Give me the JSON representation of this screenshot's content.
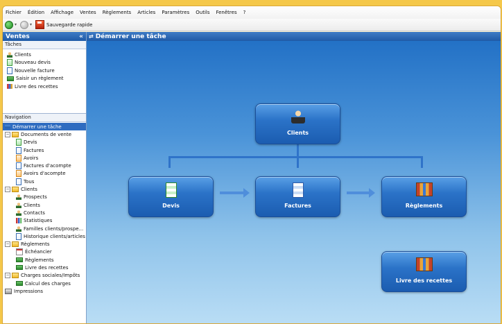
{
  "menu": [
    "Fichier",
    "Édition",
    "Affichage",
    "Ventes",
    "Règlements",
    "Articles",
    "Paramètres",
    "Outils",
    "Fenêtres",
    "?"
  ],
  "toolbar": {
    "save_label": "Sauvegarde rapide"
  },
  "sidebar": {
    "title": "Ventes",
    "collapse": "«",
    "tasks_title": "Tâches",
    "tasks": [
      "Clients",
      "Nouveau devis",
      "Nouvelle facture",
      "Saisir un règlement",
      "Livre des recettes"
    ],
    "nav_title": "Navigation",
    "tree": [
      {
        "label": "Démarrer une tâche"
      },
      {
        "label": "Documents de vente"
      },
      {
        "label": "Devis"
      },
      {
        "label": "Factures"
      },
      {
        "label": "Avoirs"
      },
      {
        "label": "Factures d'acompte"
      },
      {
        "label": "Avoirs d'acompte"
      },
      {
        "label": "Tous"
      },
      {
        "label": "Clients"
      },
      {
        "label": "Prospects"
      },
      {
        "label": "Clients"
      },
      {
        "label": "Contacts"
      },
      {
        "label": "Statistiques"
      },
      {
        "label": "Familles clients/prospe..."
      },
      {
        "label": "Historique clients/articles"
      },
      {
        "label": "Règlements"
      },
      {
        "label": "Échéancier"
      },
      {
        "label": "Règlements"
      },
      {
        "label": "Livre des recettes"
      },
      {
        "label": "Charges sociales/Impôts"
      },
      {
        "label": "Calcul des charges"
      },
      {
        "label": "Impressions"
      }
    ]
  },
  "main": {
    "title": "Démarrer une tâche",
    "tiles": {
      "clients": "Clients",
      "devis": "Devis",
      "factures": "Factures",
      "reglements": "Règlements",
      "livre": "Livre des recettes"
    }
  }
}
